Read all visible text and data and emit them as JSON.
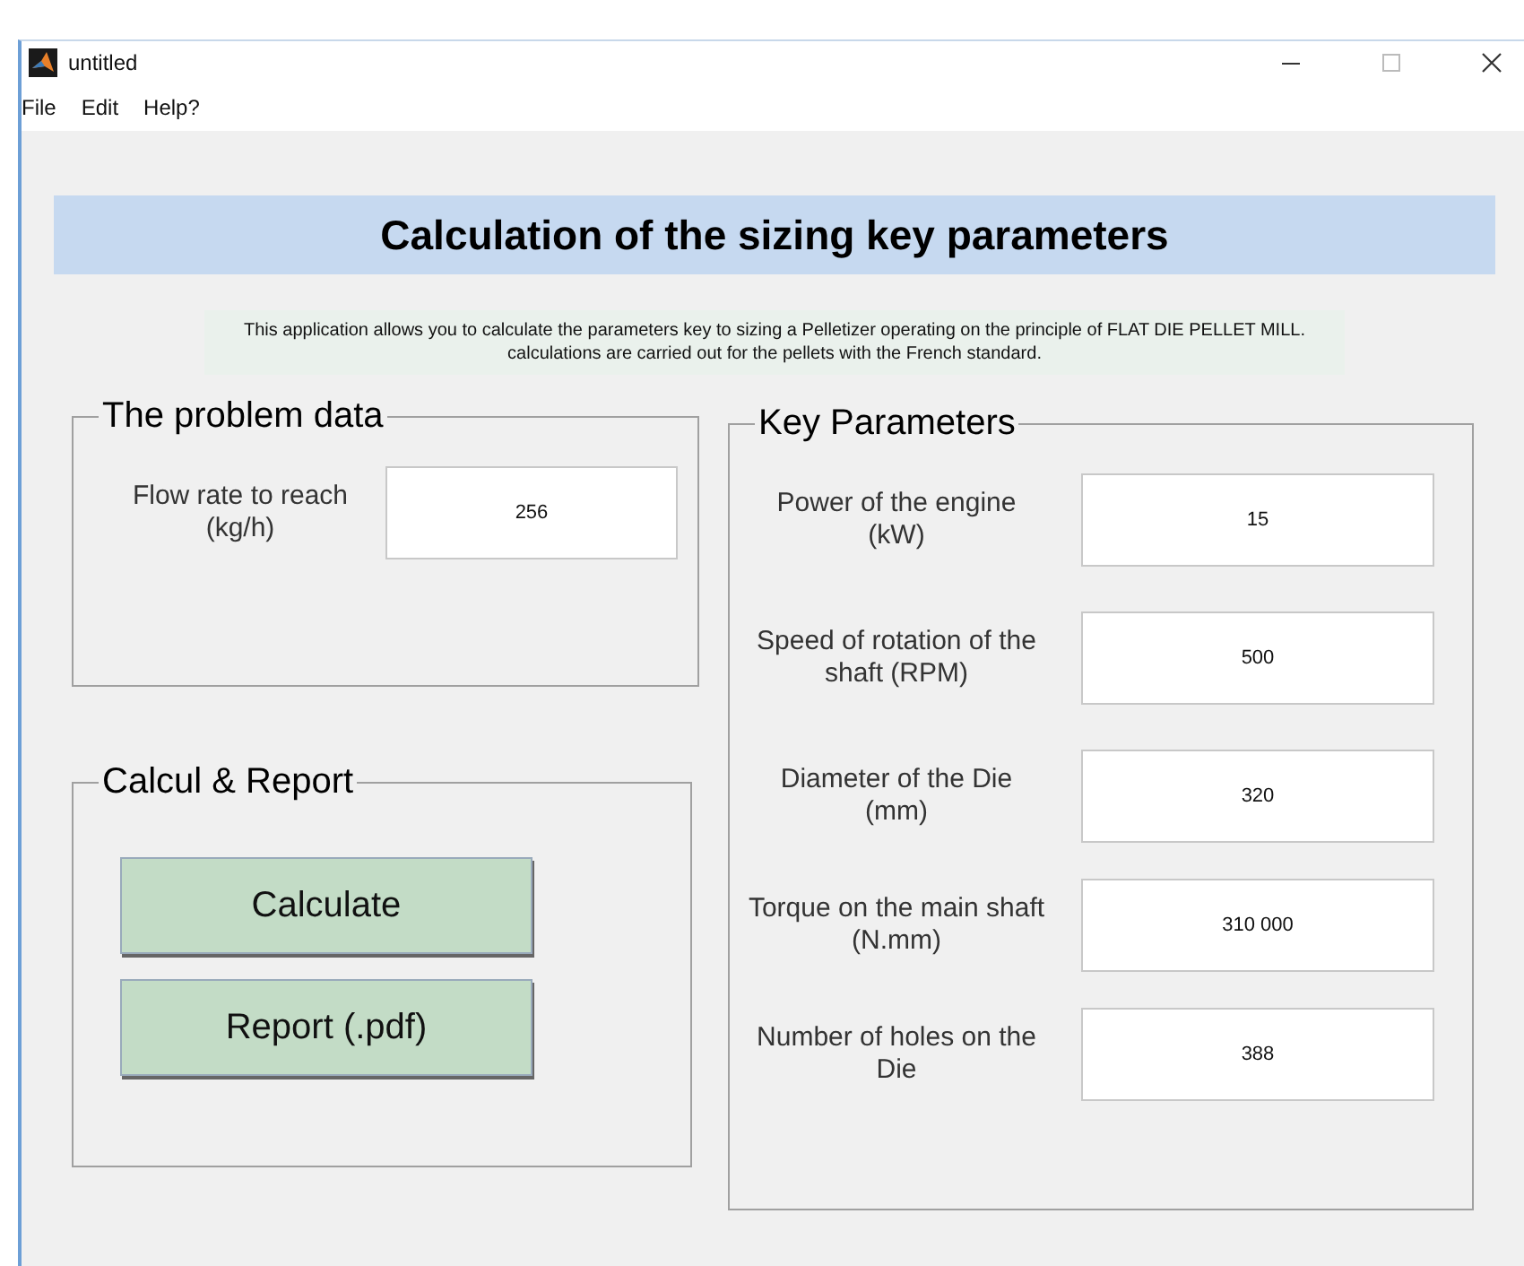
{
  "window": {
    "title": "untitled"
  },
  "menu": [
    "File",
    "Edit",
    "Help?"
  ],
  "heading": "Calculation of the sizing key parameters",
  "description": "This application allows you to calculate the parameters key to sizing a Pelletizer operating on the principle of FLAT DIE PELLET MILL. calculations are carried out for the pellets with the French standard.",
  "problem_data": {
    "title": "The problem data",
    "fields": [
      {
        "label": "Flow rate to reach (kg/h)",
        "value": "256"
      }
    ]
  },
  "calcul_report": {
    "title": "Calcul & Report",
    "buttons": [
      "Calculate",
      "Report (.pdf)"
    ]
  },
  "key_parameters": {
    "title": "Key Parameters",
    "fields": [
      {
        "label": "Power of the engine (kW)",
        "value": "15"
      },
      {
        "label": "Speed of rotation of the shaft (RPM)",
        "value": "500"
      },
      {
        "label": "Diameter of the Die (mm)",
        "value": "320"
      },
      {
        "label": "Torque on the main shaft (N.mm)",
        "value": "310 000"
      },
      {
        "label": "Number of holes on the Die",
        "value": "388"
      }
    ]
  }
}
